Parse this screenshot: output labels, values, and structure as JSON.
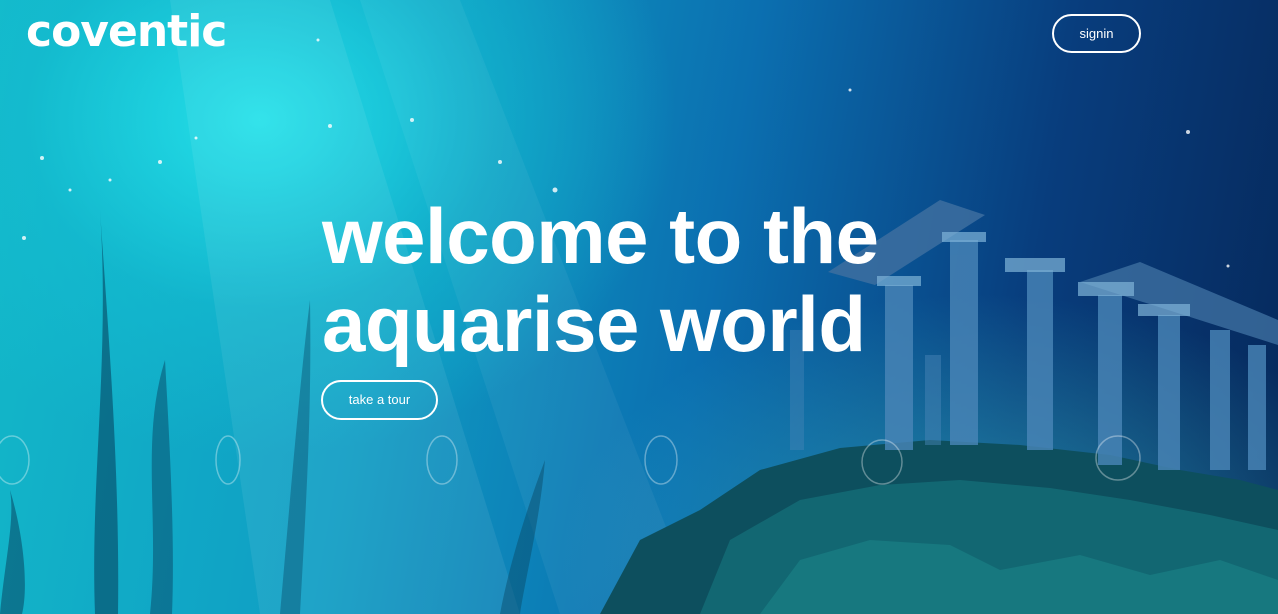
{
  "brand": {
    "logo_text": "coventic"
  },
  "nav": {
    "signin_label": "signin"
  },
  "hero": {
    "headline_line1": "welcome to the",
    "headline_line2": "aquarise world",
    "cta_label": "take a tour"
  },
  "colors": {
    "text": "#ffffff",
    "water_light": "#1fd6e0",
    "water_deep": "#06285a"
  }
}
